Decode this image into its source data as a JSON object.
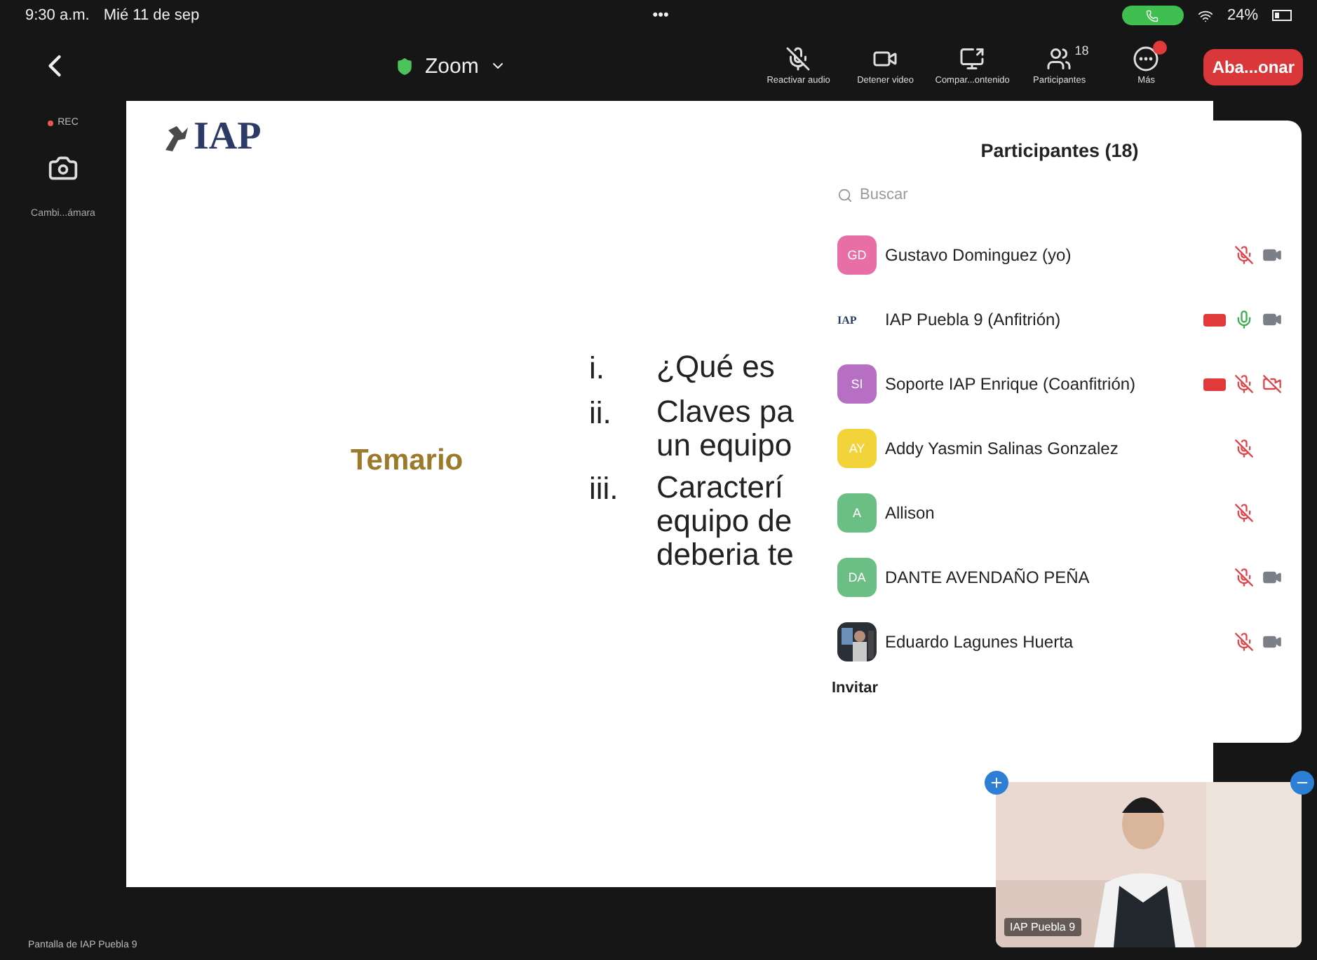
{
  "status_bar": {
    "time": "9:30 a.m.",
    "date": "Mié 11 de sep",
    "dots": "•••",
    "battery": "24%"
  },
  "toolbar": {
    "title": "Zoom",
    "leave": "Aba...onar",
    "buttons": [
      {
        "kind": "mic-off",
        "label": "Reactivar audio"
      },
      {
        "kind": "video",
        "label": "Detener video"
      },
      {
        "kind": "share",
        "label": "Compar...ontenido"
      },
      {
        "kind": "participants",
        "label": "Participantes",
        "count": "18"
      },
      {
        "kind": "more",
        "label": "Más",
        "badge": true
      }
    ]
  },
  "side": {
    "rec": "REC",
    "camera_label": "Cambi...ámara"
  },
  "slide": {
    "logo": "IAP",
    "title": "Temario",
    "items": [
      {
        "number": "i.",
        "lines": [
          "¿Qué es"
        ]
      },
      {
        "number": "ii.",
        "lines": [
          "Claves pa",
          "un equipo"
        ]
      },
      {
        "number": "iii.",
        "lines": [
          "Caracterí",
          "equipo de",
          "deberia te"
        ]
      }
    ]
  },
  "panel": {
    "title": "Participantes (18)",
    "search_placeholder": "Buscar",
    "invite": "Invitar",
    "participants": [
      {
        "kind": "initials",
        "initials": "GD",
        "color": "#e86fa6",
        "name": "Gustavo Dominguez (yo)",
        "recording": false,
        "mic_muted": true,
        "video_muted": false
      },
      {
        "kind": "logo",
        "initials": "IAP",
        "name": "IAP Puebla 9 (Anfitrión)",
        "recording": true,
        "mic_muted": false,
        "video_muted": false
      },
      {
        "kind": "initials",
        "initials": "SI",
        "color": "#b76fc4",
        "name": "Soporte IAP Enrique (Coanfitrión)",
        "recording": true,
        "mic_muted": true,
        "video_muted": true
      },
      {
        "kind": "initials",
        "initials": "AY",
        "color": "#f2d43a",
        "name": "Addy Yasmin Salinas Gonzalez",
        "recording": false,
        "mic_muted": true
      },
      {
        "kind": "initials",
        "initials": "A",
        "color": "#6cbf84",
        "name": "Allison",
        "recording": false,
        "mic_muted": true
      },
      {
        "kind": "initials",
        "initials": "DA",
        "color": "#6cbf84",
        "name": "DANTE AVENDAÑO PEÑA",
        "recording": false,
        "mic_muted": true,
        "video_muted": false
      },
      {
        "name": "Eduardo Lagunes Huerta",
        "recording": false,
        "mic_muted": true,
        "video_muted": false
      }
    ]
  },
  "video_tile": {
    "name": "IAP Puebla 9",
    "kind": "picture"
  },
  "footer": "Pantalla de IAP Puebla 9"
}
